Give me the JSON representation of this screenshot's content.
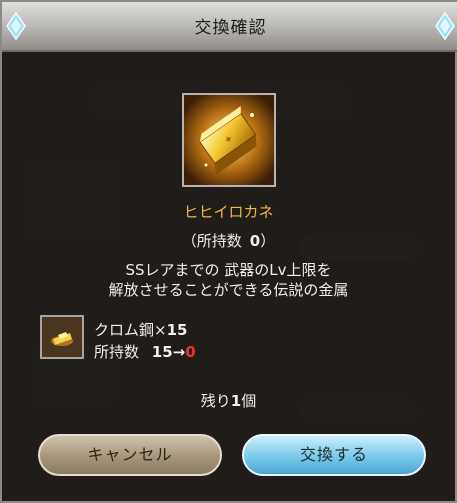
{
  "dialog": {
    "title": "交換確認",
    "item": {
      "name": "ヒヒイロカネ",
      "owned_prefix": "（所持数",
      "owned_count": "0",
      "owned_suffix": "）",
      "icon": "gold-ingot-icon"
    },
    "description_line1": "SSレアまでの 武器のLv上限を",
    "description_line2": "解放させることができる伝説の金属",
    "cost": {
      "icon": "chrome-steel-icon",
      "material_name": "クロム鋼×",
      "material_qty": "15",
      "owned_label": "所持数",
      "owned_before": "15→",
      "owned_after": "0"
    },
    "remaining_prefix": "残り",
    "remaining_count": "1",
    "remaining_suffix": "個",
    "buttons": {
      "cancel_label": "キャンセル",
      "confirm_label": "交換する"
    }
  },
  "colors": {
    "item_name": "#f0b93a",
    "after_value": "#e8382a",
    "confirm_button": "#79c9ea",
    "cancel_button": "#a7957a"
  }
}
